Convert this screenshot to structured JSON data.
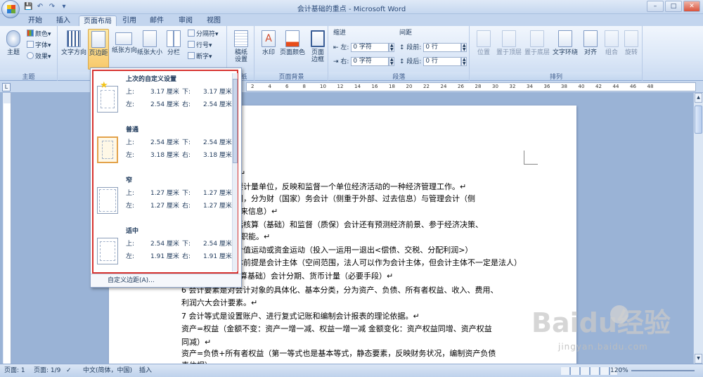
{
  "window": {
    "title": "会计基础的重点 - Microsoft Word",
    "controls": [
      "–",
      "□",
      "✕"
    ]
  },
  "qat": [
    "💾",
    "↶",
    "↷",
    "▾"
  ],
  "tabs": [
    "开始",
    "插入",
    "页面布局",
    "引用",
    "邮件",
    "审阅",
    "视图"
  ],
  "active_tab": "页面布局",
  "ribbon": {
    "theme": {
      "big": "主题",
      "colors": "颜色▾",
      "fonts": "字体▾",
      "effects": "效果▾",
      "group": "主题"
    },
    "page_setup": {
      "text_dir": "文字方向",
      "margins": "页边距",
      "orientation": "纸张方向",
      "size": "纸张大小",
      "columns": "分栏",
      "breaks": "分隔符▾",
      "line_numbers": "行号▾",
      "hyphenation": "断字▾",
      "group": "页面设置"
    },
    "draft": {
      "label": "稿纸\n设置",
      "group": "稿纸"
    },
    "background": {
      "watermark": "水印",
      "page_color": "页面颜色",
      "page_border": "页面\n边框",
      "group": "页面背景"
    },
    "paragraph": {
      "indent_label": "缩进",
      "spacing_label": "间距",
      "left_label": "左:",
      "left_value": "0 字符",
      "right_label": "右:",
      "right_value": "0 字符",
      "before_label": "段前:",
      "before_value": "0 行",
      "after_label": "段后:",
      "after_value": "0 行",
      "group": "段落"
    },
    "arrange": {
      "position": "位置",
      "front": "置于顶层",
      "back": "置于底层",
      "wrap": "文字环绕",
      "align": "对齐",
      "group_btn": "组合",
      "rotate": "旋转",
      "group": "排列"
    }
  },
  "ruler": [
    "2",
    "4",
    "6",
    "8",
    "10",
    "12",
    "14",
    "16",
    "18",
    "20",
    "22",
    "24",
    "26",
    "28",
    "30",
    "32",
    "34",
    "36",
    "38",
    "40",
    "42",
    "44",
    "46",
    "48"
  ],
  "margin_menu": {
    "items": [
      {
        "name": "上次的自定义设置",
        "top": "上:",
        "tv": "3.17 厘米",
        "bottom": "下:",
        "bv": "3.17 厘米",
        "left": "左:",
        "lv": "2.54 厘米",
        "right": "右:",
        "rv": "2.54 厘米"
      },
      {
        "name": "普通",
        "top": "上:",
        "tv": "2.54 厘米",
        "bottom": "下:",
        "bv": "2.54 厘米",
        "left": "左:",
        "lv": "3.18 厘米",
        "right": "右:",
        "rv": "3.18 厘米"
      },
      {
        "name": "窄",
        "top": "上:",
        "tv": "1.27 厘米",
        "bottom": "下:",
        "bv": "1.27 厘米",
        "left": "左:",
        "lv": "1.27 厘米",
        "right": "右:",
        "rv": "1.27 厘米"
      },
      {
        "name": "适中",
        "top": "上:",
        "tv": "2.54 厘米",
        "bottom": "下:",
        "bv": "2.54 厘米",
        "left": "左:",
        "lv": "1.91 厘米",
        "right": "右:",
        "rv": "1.91 厘米"
      }
    ],
    "footer": "自定义边距(A)..."
  },
  "document": {
    "lines": [
      "↵",
      "为主要计量单位，反映和监督一个单位经济活动的一种经济管理工作。↵",
      "象不同，分为财（国家）务会计（侧重于外部、过去信息）与管理会计（侧",
      "来信息）↵",
      "能包括核算（基础）和监督（质保）会计还有预测经济前景、参于经济决策、",
      "职能。↵",
      "价值运动或资金运动（投入一运用一退出<偿债、交税、分配利润>）",
      "本前提是会计主体（空间范围，法人可以作为会计主体，但会计主体不一定是法人）",
      "核算基础）会计分期、货币计量（必要手段）↵",
      "6 会计要素是对会计对象的具体化、基本分类，分为资产、负债、所有者权益、收入、费用、",
      "利润六大会计要素。↵",
      "7 会计等式是设置账户、进行复式记账和编制会计报表的理论依据。↵",
      "资产=权益（金额不变：资产一增一减、权益一增一减 金额变化：资产权益同增、资产权益",
      "同减）↵",
      "资产=负债+所有者权益（第一等式也是基本等式，静态要素，反映财务状况，编制资产负债",
      "表依据）"
    ]
  },
  "statusbar": {
    "page": "页面: 1",
    "pages": "页面: 1/9",
    "lang": "中文(简体，中国)",
    "mode": "插入",
    "zoom": "120%"
  },
  "watermark": {
    "text": "Baidu经验",
    "sub": "jingyan.baidu.com"
  }
}
